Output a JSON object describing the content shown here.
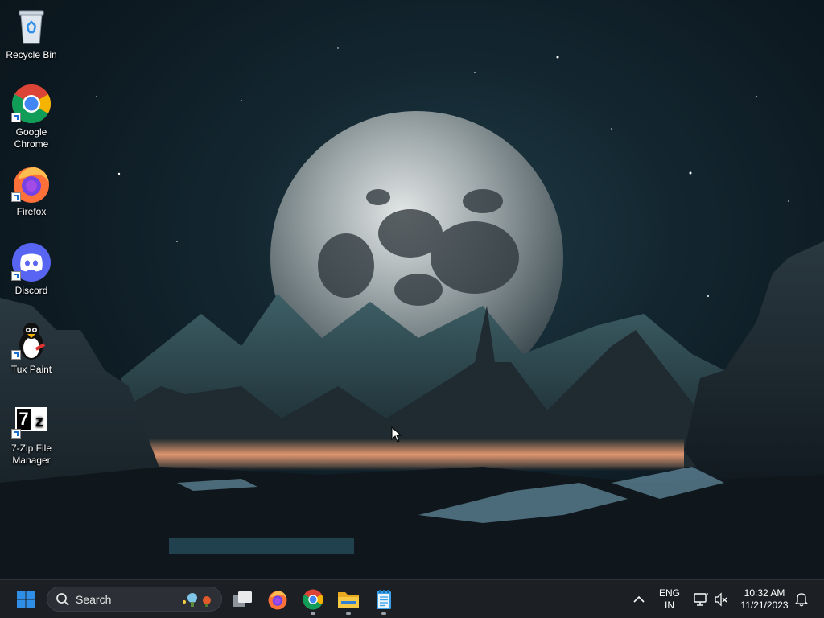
{
  "desktop": {
    "icons": [
      {
        "label": "Recycle Bin",
        "icon": "recycle-bin-icon",
        "shortcut": false
      },
      {
        "label": "Google Chrome",
        "icon": "chrome-icon",
        "shortcut": true
      },
      {
        "label": "Firefox",
        "icon": "firefox-icon",
        "shortcut": true
      },
      {
        "label": "Discord",
        "icon": "discord-icon",
        "shortcut": true
      },
      {
        "label": "Tux Paint",
        "icon": "tux-paint-icon",
        "shortcut": true
      },
      {
        "label": "7-Zip File Manager",
        "icon": "7zip-icon",
        "shortcut": true
      }
    ],
    "wallpaper": "moon-over-mountains-night"
  },
  "taskbar": {
    "start_icon": "windows-start-icon",
    "search": {
      "placeholder": "Search"
    },
    "apps": [
      {
        "name": "task-view",
        "icon": "task-view-icon",
        "running": false
      },
      {
        "name": "firefox",
        "icon": "firefox-icon",
        "running": false
      },
      {
        "name": "chrome",
        "icon": "chrome-icon",
        "running": true
      },
      {
        "name": "file-explorer",
        "icon": "folder-icon",
        "running": true
      },
      {
        "name": "notepad",
        "icon": "notepad-icon",
        "running": true
      }
    ],
    "tray": {
      "overflow_icon": "chevron-up-icon",
      "language_line1": "ENG",
      "language_line2": "IN",
      "network_icon": "network-icon",
      "volume_icon": "volume-muted-icon",
      "time": "10:32 AM",
      "date": "11/21/2023",
      "notification_icon": "bell-icon"
    }
  },
  "colors": {
    "taskbar_bg": "#1c1f24",
    "windows_blue": "#2f8fe6",
    "discord": "#5865f2"
  }
}
